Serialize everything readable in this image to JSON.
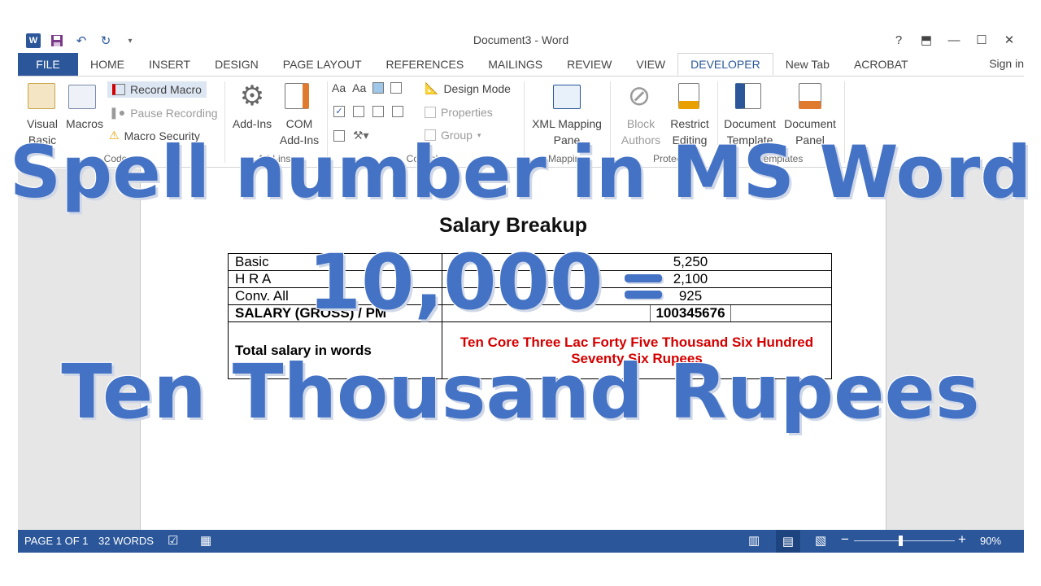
{
  "titlebar": {
    "title": "Document3 - Word",
    "help": "?",
    "restore_ribbon": "⬒",
    "minimize": "—",
    "maximize": "☐",
    "close": "✕"
  },
  "tabs": [
    {
      "label": "FILE"
    },
    {
      "label": "HOME"
    },
    {
      "label": "INSERT"
    },
    {
      "label": "DESIGN"
    },
    {
      "label": "PAGE LAYOUT"
    },
    {
      "label": "REFERENCES"
    },
    {
      "label": "MAILINGS"
    },
    {
      "label": "REVIEW"
    },
    {
      "label": "VIEW"
    },
    {
      "label": "DEVELOPER"
    },
    {
      "label": "New Tab"
    },
    {
      "label": "ACROBAT"
    }
  ],
  "sign_in": "Sign in",
  "ribbon": {
    "visual_basic": [
      "Visual",
      "Basic"
    ],
    "macros": "Macros",
    "record_macro": "Record Macro",
    "pause_recording": "Pause Recording",
    "macro_security": "Macro Security",
    "group_code": "Code",
    "add_ins": "Add-Ins",
    "com_add_ins": [
      "COM",
      "Add-Ins"
    ],
    "group_add_ins": "Add-ins",
    "design_mode": "Design Mode",
    "properties": "Properties",
    "group": "Group",
    "group_controls": "Controls",
    "xml_mapping": [
      "XML Mapping",
      "Pane"
    ],
    "group_mapping": "Mapping",
    "block_authors": [
      "Block",
      "Authors"
    ],
    "restrict_editing": [
      "Restrict",
      "Editing"
    ],
    "group_protect": "Protect",
    "document_template": [
      "Document",
      "Template"
    ],
    "document_panel": [
      "Document",
      "Panel"
    ],
    "group_templates": "Templates"
  },
  "document": {
    "heading": "Salary Breakup",
    "rows": [
      {
        "label": "Basic",
        "value": "5,250"
      },
      {
        "label": "H R A",
        "value": "2,100"
      },
      {
        "label": "Conv. All",
        "value": "925"
      }
    ],
    "gross_label": "SALARY (GROSS) / PM",
    "gross_value": "100345676",
    "words_label": "Total salary in words",
    "words_value": "Ten Core Three Lac Forty Five Thousand Six Hundred Seventy Six Rupees"
  },
  "statusbar": {
    "page": "PAGE 1 OF 1",
    "words": "32 WORDS",
    "zoom": "90%"
  },
  "overlay": {
    "line1": "Spell number in MS Word",
    "line2": "10,000",
    "line3": "Ten Thousand Rupees"
  },
  "colors": {
    "accent": "#2b579a",
    "overlay": "#4472c4",
    "red_text": "#d40000"
  }
}
